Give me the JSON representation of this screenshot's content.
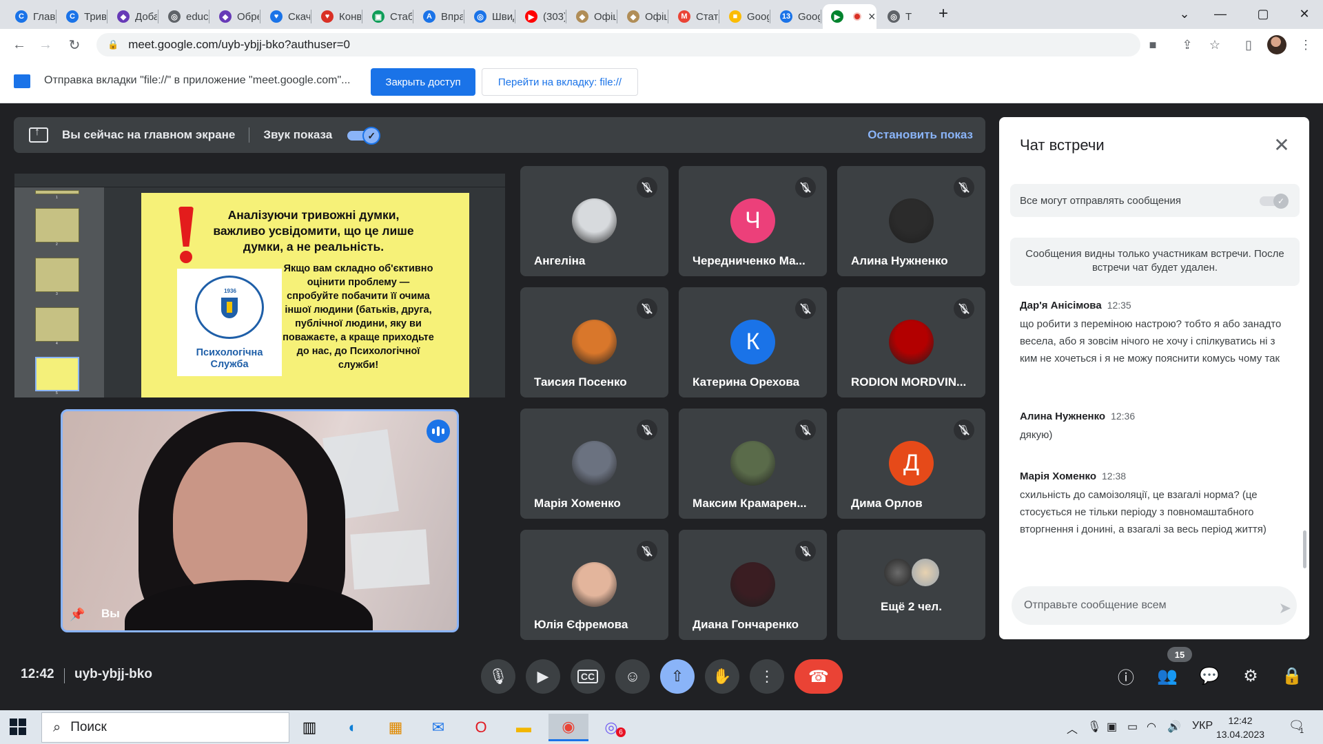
{
  "browser": {
    "tabs": [
      {
        "label": "Главн",
        "color": "#1a73e8",
        "glyph": "C"
      },
      {
        "label": "Триво",
        "color": "#1a73e8",
        "glyph": "C"
      },
      {
        "label": "Добав",
        "color": "#673ab7",
        "glyph": "◆"
      },
      {
        "label": "educ_",
        "color": "#5f6368",
        "glyph": "◎"
      },
      {
        "label": "Обре",
        "color": "#673ab7",
        "glyph": "◆"
      },
      {
        "label": "Скача",
        "color": "#1a73e8",
        "glyph": "♥"
      },
      {
        "label": "Конве",
        "color": "#d93025",
        "glyph": "♥"
      },
      {
        "label": "Стабі",
        "color": "#0f9d58",
        "glyph": "▣"
      },
      {
        "label": "Впра",
        "color": "#1a73e8",
        "glyph": "A"
      },
      {
        "label": "Швид",
        "color": "#1a73e8",
        "glyph": "◎"
      },
      {
        "label": "(303)",
        "color": "#ff0000",
        "glyph": "▶"
      },
      {
        "label": "Офіц",
        "color": "#b08d57",
        "glyph": "◆"
      },
      {
        "label": "Офіц",
        "color": "#b08d57",
        "glyph": "◆"
      },
      {
        "label": "Стат",
        "color": "#ea4335",
        "glyph": "M"
      },
      {
        "label": "Goog",
        "color": "#fbbc04",
        "glyph": "■"
      },
      {
        "label": "Goog",
        "color": "#1a73e8",
        "glyph": "13"
      }
    ],
    "active_tab": {
      "color": "#00832d",
      "glyph": "▶"
    },
    "last_tab": {
      "label": "Т",
      "color": "#5f6368",
      "glyph": "◎"
    },
    "new_tab": "+",
    "url": "meet.google.com/uyb-ybjj-bko?authuser=0"
  },
  "infobar": {
    "text": "Отправка вкладки \"file://\" в приложение \"meet.google.com\"...",
    "stop_sharing": "Закрыть доступ",
    "goto_tab": "Перейти на вкладку: file://"
  },
  "present_banner": {
    "status": "Вы сейчас на главном экране",
    "sound_label": "Звук показа",
    "sound_on": true,
    "stop_label": "Остановить показ"
  },
  "slide": {
    "thumb_numbers": [
      "1",
      "2",
      "3",
      "4",
      "5"
    ],
    "logo_year": "1936",
    "heading": "Аналізуючи тривожні думки, важливо усвідомити, що це лише думки, а не реальність.",
    "body": "Якщо вам складно об'єктивно оцінити проблему — спробуйте побачити її очима іншої людини (батьків, друга, публічної людини, яку ви поважаєте, а краще приходьте до нас, до Психологічної служби!",
    "logo_text": "Психологічна Служба"
  },
  "self_tile": {
    "name": "Вы"
  },
  "participants": [
    {
      "name": "Ангеліна",
      "avatar_type": "photo",
      "avatar_color": "#d7dadd",
      "initial": ""
    },
    {
      "name": "Чередниченко Ма...",
      "avatar_type": "letter",
      "avatar_color": "#ec407a",
      "initial": "Ч"
    },
    {
      "name": "Алина Нужненко",
      "avatar_type": "photo",
      "avatar_color": "#2b2b2b",
      "initial": ""
    },
    {
      "name": "Таисия Посенко",
      "avatar_type": "photo",
      "avatar_color": "#d9772b",
      "initial": ""
    },
    {
      "name": "Катерина Орехова",
      "avatar_type": "letter",
      "avatar_color": "#1a73e8",
      "initial": "К"
    },
    {
      "name": "RODION MORDVIN...",
      "avatar_type": "photo",
      "avatar_color": "#b30000",
      "initial": ""
    },
    {
      "name": "Марія Хоменко",
      "avatar_type": "photo",
      "avatar_color": "#6b7280",
      "initial": ""
    },
    {
      "name": "Максим Крамарен...",
      "avatar_type": "photo",
      "avatar_color": "#5a6b4a",
      "initial": ""
    },
    {
      "name": "Дима Орлов",
      "avatar_type": "letter",
      "avatar_color": "#e64a19",
      "initial": "Д"
    },
    {
      "name": "Юлія Єфремова",
      "avatar_type": "photo",
      "avatar_color": "#e3b59c",
      "initial": ""
    },
    {
      "name": "Диана Гончаренко",
      "avatar_type": "photo",
      "avatar_color": "#3a1d22",
      "initial": ""
    }
  ],
  "more_tile": {
    "label": "Ещё 2 чел."
  },
  "chat": {
    "title": "Чат встречи",
    "setting_label": "Все могут отправлять сообщения",
    "notice": "Сообщения видны только участникам встречи. После встречи чат будет удален.",
    "messages": [
      {
        "author": "Дар'я Анісімова",
        "time": "12:35",
        "text": "що робити з переміною настрою? тобто я або занадто весела, або я зовсім нічого не хочу і спілкуватись ні з ким не хочеться і я не можу пояснити комусь чому так"
      },
      {
        "author": "Алина Нужненко",
        "time": "12:36",
        "text": "дякую)"
      },
      {
        "author": "Марія Хоменко",
        "time": "12:38",
        "text": "схильність до самоізоляції, це взагалі норма? (це стосується не тільки періоду з повномаштабного вторгнення і донині, а взагалі за весь період життя)"
      }
    ],
    "input_placeholder": "Отправьте сообщение всем"
  },
  "bottom_bar": {
    "time": "12:42",
    "meeting_code": "uyb-ybjj-bko",
    "participants_count": "15"
  },
  "taskbar": {
    "search_placeholder": "Поиск",
    "notif_count": "1",
    "language": "УКР",
    "time": "12:42",
    "date": "13.04.2023"
  }
}
